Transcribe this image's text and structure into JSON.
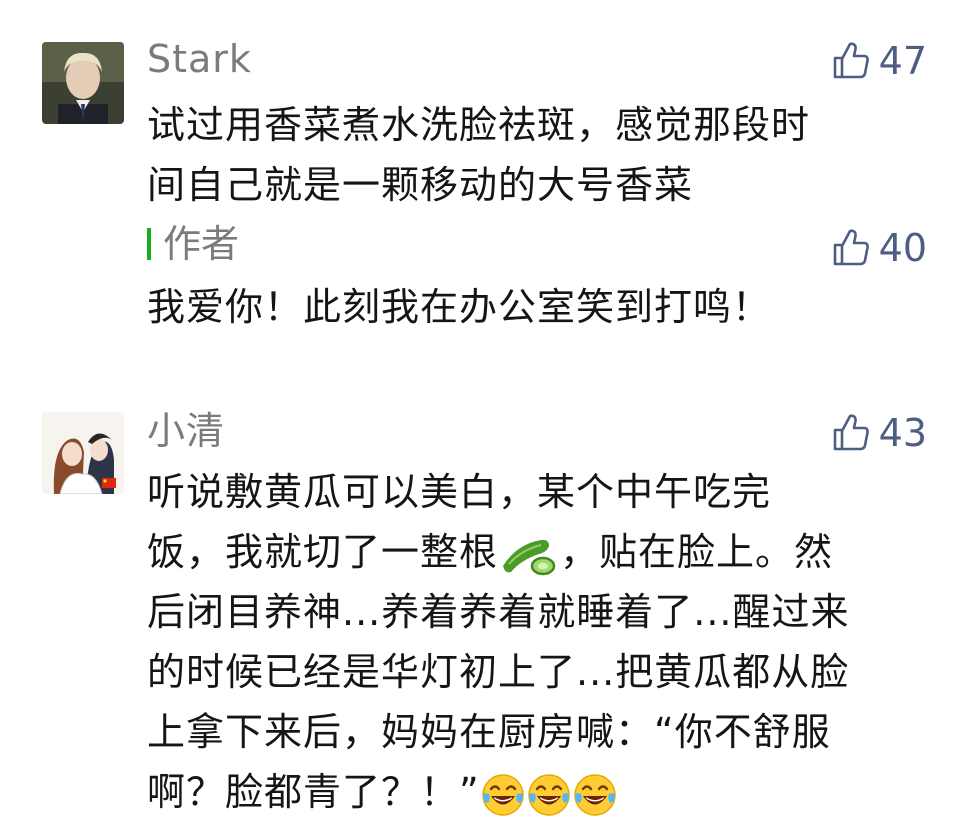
{
  "comments": [
    {
      "username": "Stark",
      "likes": "47",
      "text": "试过用香菜煮水洗脸祛斑，感觉那段时\n间自己就是一颗移动的大号香菜",
      "reply": {
        "author_label": "作者",
        "likes": "40",
        "text": "我爱你！此刻我在办公室笑到打鸣！"
      }
    },
    {
      "username": "小清",
      "likes": "43",
      "text_parts": [
        "听说敷黄瓜可以美白，某个中午吃完\n饭，我就切了一整根",
        "，贴在脸上。然\n后闭目养神...养着养着就睡着了...醒过来\n的时候已经是华灯初上了...把黄瓜都从脸\n上拿下来后，妈妈在厨房喊：“你不舒服\n啊？脸都青了？！”"
      ],
      "emojis": [
        "cucumber-emoji",
        "laughing-tears-emoji",
        "laughing-tears-emoji",
        "laughing-tears-emoji"
      ]
    }
  ],
  "colors": {
    "username": "#7b7b7b",
    "like": "#4d5e82",
    "author_bar": "#1aad19",
    "text": "#151515"
  }
}
